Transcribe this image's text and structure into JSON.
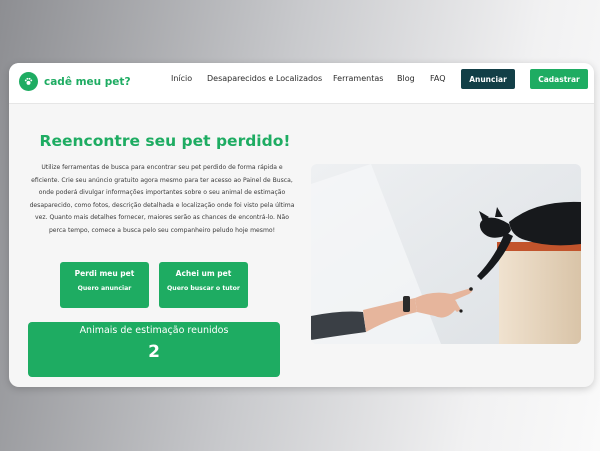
{
  "brand": {
    "name": "cadê meu pet?",
    "color": "#1eac62",
    "icon": "paw-pin-icon"
  },
  "nav": {
    "items": [
      "Início",
      "Desaparecidos e Localizados",
      "Ferramentas",
      "Blog",
      "FAQ"
    ],
    "announce_label": "Anunciar",
    "register_label": "Cadastrar"
  },
  "hero": {
    "title": "Reencontre seu pet perdido!",
    "description": "Utilize ferramentas de busca para encontrar seu pet perdido de forma rápida e eficiente. Crie seu anúncio gratuito agora mesmo para ter acesso ao Painel de Busca, onde poderá divulgar informações importantes sobre o seu animal de estimação desaparecido, como fotos, descrição detalhada e localização onde foi visto pela última vez. Quanto mais detalhes fornecer, maiores serão as chances de encontrá-lo. Não perca tempo, comece a busca pelo seu companheiro peludo hoje mesmo!",
    "lost_button": {
      "title": "Perdi meu pet",
      "subtitle": "Quero anunciar"
    },
    "found_button": {
      "title": "Achei um pet",
      "subtitle": "Quero buscar o tutor"
    }
  },
  "stats": {
    "label": "Animais de estimação reunidos",
    "value": "2"
  },
  "colors": {
    "primary": "#1eac62",
    "dark": "#123f47",
    "text": "#2b2b2b"
  },
  "image": {
    "subject": "black cat reaching down from a ledge toward a human hand"
  }
}
